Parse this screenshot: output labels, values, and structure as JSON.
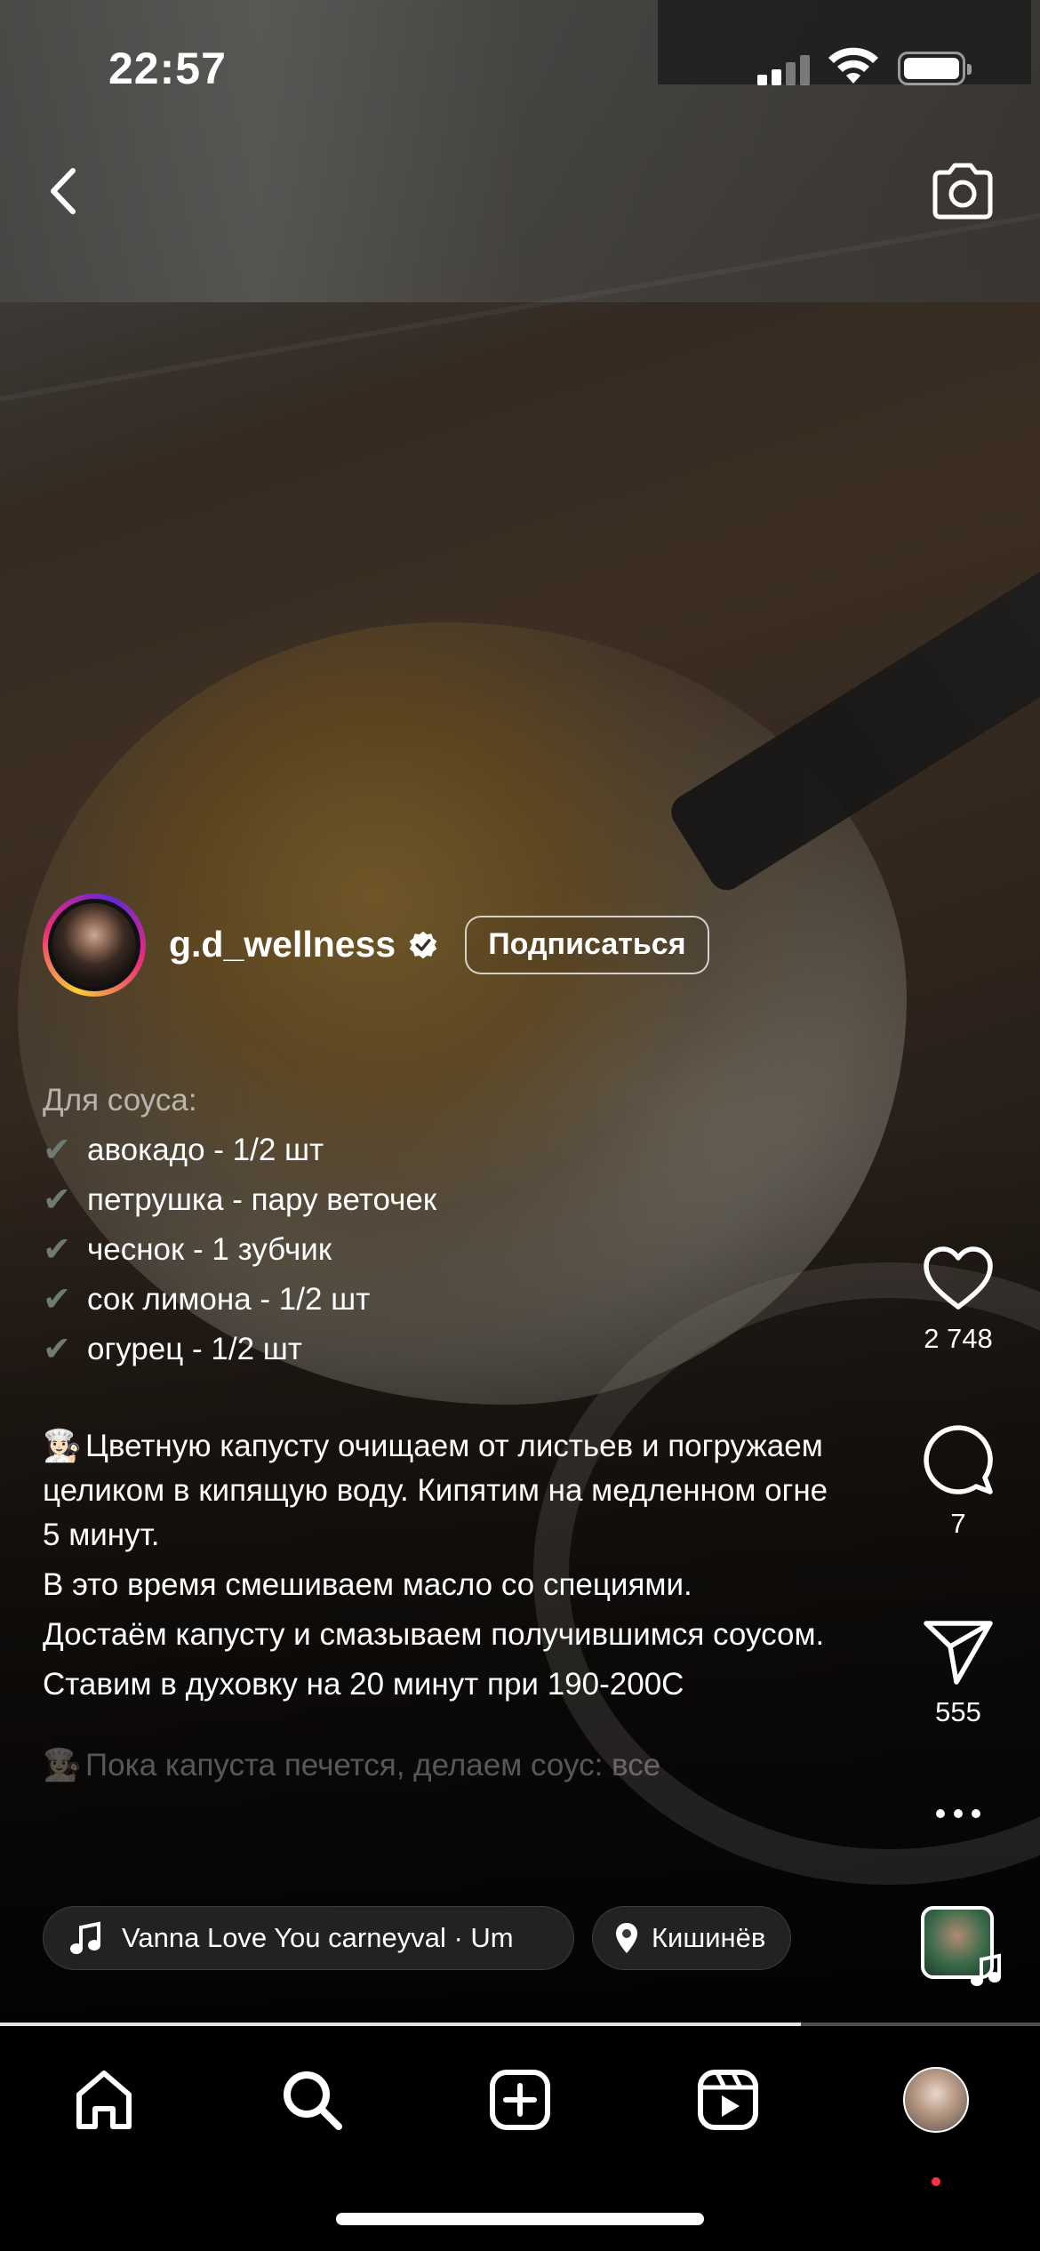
{
  "status_bar": {
    "time": "22:57"
  },
  "author": {
    "username": "g.d_wellness",
    "follow_label": "Подписаться"
  },
  "caption": {
    "sauce_title": "Для соуса:",
    "check_glyph": "✔",
    "ingredients": [
      "авокадо - 1/2 шт",
      "петрушка - пару веточек",
      "чеснок - 1 зубчик",
      "сок лимона - 1/2 шт",
      "огурец - 1/2 шт"
    ],
    "chef_glyph": "👩🏻‍🍳",
    "steps": [
      "Цветную капусту очищаем от листьев и погружаем целиком в кипящую воду. Кипятим на медленном огне 5 минут.",
      "В это время смешиваем масло со специями.",
      "Достаём капусту  и смазываем получившимся соусом.",
      "Ставим в духовку на 20 минут при 190-200С"
    ],
    "truncated_line": "Пока капуста печется, делаем соус: все"
  },
  "actions": {
    "likes": "2 748",
    "comments": "7",
    "shares": "555"
  },
  "music": {
    "text": "Vanna Love You     carneyval · Um"
  },
  "location": {
    "text": "Кишинёв"
  },
  "progress_fraction": 0.77,
  "icons": {
    "back": "chevron-left-icon",
    "camera": "camera-icon",
    "like": "heart-icon",
    "comment": "comment-bubble-icon",
    "share": "paper-plane-icon",
    "more": "more-dots-icon",
    "music": "music-note-icon",
    "location": "location-pin-icon",
    "nav": [
      "home-icon",
      "search-icon",
      "create-icon",
      "reels-icon",
      "profile-avatar"
    ]
  },
  "colors": {
    "background": "#000000",
    "text": "#ffffff",
    "notification_dot": "#ff3040"
  }
}
